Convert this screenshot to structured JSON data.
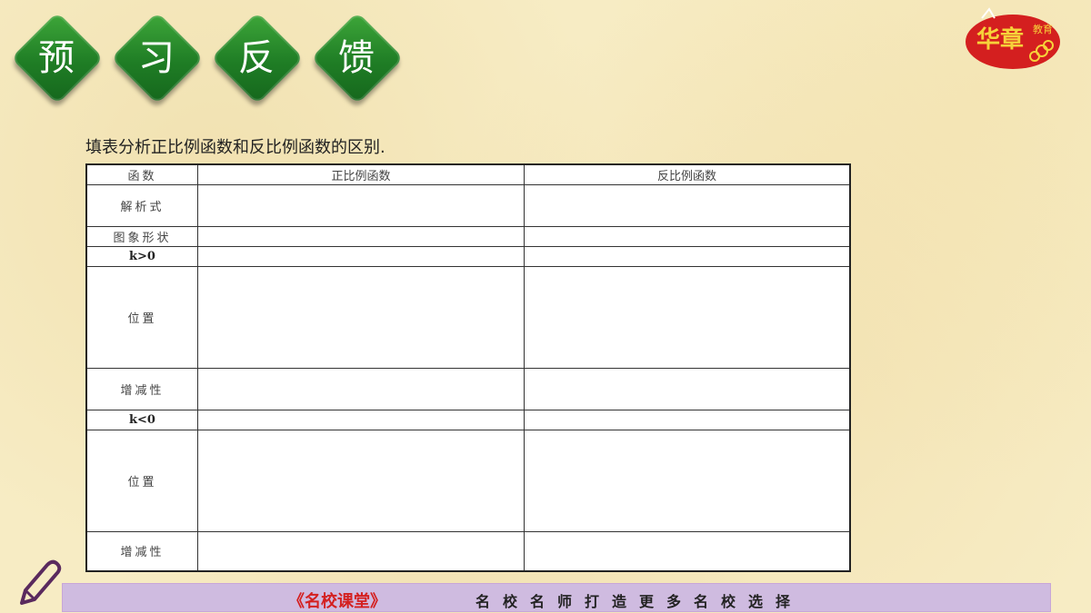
{
  "banner": {
    "chars": [
      "预",
      "习",
      "反",
      "馈"
    ]
  },
  "logo": {
    "text": "华章教育",
    "bg_color": "#d41f1f",
    "text_color": "#f6d23a"
  },
  "instruction": "填表分析正比例函数和反比例函数的区别.",
  "table": {
    "headers": [
      "函数",
      "正比例函数",
      "反比例函数"
    ],
    "rows": [
      {
        "label": "解析式",
        "col2": "",
        "col3": ""
      },
      {
        "label": "图象形状",
        "col2": "",
        "col3": ""
      },
      {
        "label": "k>0",
        "col2": "",
        "col3": ""
      },
      {
        "label": "位置",
        "col2": "",
        "col3": ""
      },
      {
        "label": "增减性",
        "col2": "",
        "col3": ""
      },
      {
        "label": "k<0",
        "col2": "",
        "col3": ""
      },
      {
        "label": "位置",
        "col2": "",
        "col3": ""
      },
      {
        "label": "增减性",
        "col2": "",
        "col3": ""
      }
    ]
  },
  "footer": {
    "brand": "《名校课堂》",
    "slogan": "名校名师打造更多名校选择",
    "bg_color": "#cfbbe0"
  },
  "icons": {
    "pencil": "pencil-icon"
  }
}
